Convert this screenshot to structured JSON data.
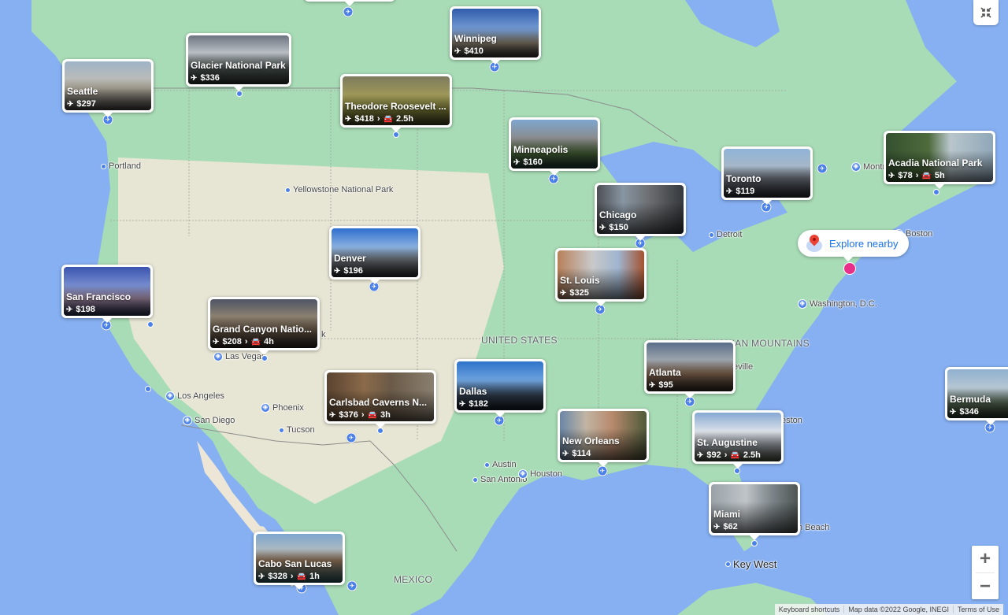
{
  "map": {
    "colors": {
      "water": "#86b0f2",
      "land_green": "#a8dcb6",
      "land_tan": "#efe9dc",
      "pin_blue": "#4a80e8",
      "current_location": "#e8308a",
      "explore_text": "#1a73e8"
    },
    "region_labels": [
      {
        "text": "UNITED STATES"
      },
      {
        "text": "MEXICO"
      },
      {
        "text": "APPALACHIAN MOUNTAINS"
      }
    ],
    "place_labels": [
      {
        "text": "Portland"
      },
      {
        "text": "Yellowstone National Park"
      },
      {
        "text": "Las Vegas"
      },
      {
        "text": "Los Angeles"
      },
      {
        "text": "San Diego"
      },
      {
        "text": "Phoenix"
      },
      {
        "text": "Tucson"
      },
      {
        "text": "Austin"
      },
      {
        "text": "San Antonio"
      },
      {
        "text": "Houston"
      },
      {
        "text": "Detroit"
      },
      {
        "text": "Boston"
      },
      {
        "text": "Washington, D.C."
      },
      {
        "text": "Montr"
      },
      {
        "text": "eville"
      },
      {
        "text": "eston"
      },
      {
        "text": "n Beach"
      },
      {
        "text": "Key West"
      },
      {
        "text": "k"
      }
    ],
    "destinations": [
      {
        "name": "Seattle",
        "price": "$297",
        "transfer": null
      },
      {
        "name": "Glacier National Park",
        "price": "$336",
        "transfer": null
      },
      {
        "name": "Winnipeg",
        "price": "$410",
        "transfer": null
      },
      {
        "name": "Theodore Roosevelt ...",
        "price": "$418",
        "transfer": "2.5h"
      },
      {
        "name": "Minneapolis",
        "price": "$160",
        "transfer": null
      },
      {
        "name": "Toronto",
        "price": "$119",
        "transfer": null
      },
      {
        "name": "Acadia National Park",
        "price": "$78",
        "transfer": "5h"
      },
      {
        "name": "Chicago",
        "price": "$150",
        "transfer": null
      },
      {
        "name": "Denver",
        "price": "$196",
        "transfer": null
      },
      {
        "name": "St. Louis",
        "price": "$325",
        "transfer": null
      },
      {
        "name": "San Francisco",
        "price": "$198",
        "transfer": null
      },
      {
        "name": "Grand Canyon Natio...",
        "price": "$208",
        "transfer": "4h"
      },
      {
        "name": "Atlanta",
        "price": "$95",
        "transfer": null
      },
      {
        "name": "Carlsbad Caverns N...",
        "price": "$376",
        "transfer": "3h"
      },
      {
        "name": "Dallas",
        "price": "$182",
        "transfer": null
      },
      {
        "name": "Bermuda",
        "price": "$346",
        "transfer": null
      },
      {
        "name": "New Orleans",
        "price": "$114",
        "transfer": null
      },
      {
        "name": "St. Augustine",
        "price": "$92",
        "transfer": "2.5h"
      },
      {
        "name": "Miami",
        "price": "$62",
        "transfer": null
      },
      {
        "name": "Cabo San Lucas",
        "price": "$328",
        "transfer": "1h"
      }
    ],
    "icons": {
      "flight": "✈",
      "car": "🚘",
      "chevron": "›"
    },
    "explore_nearby": {
      "label": "Explore nearby",
      "icon": "map-pin-icon"
    },
    "controls": {
      "exit_fullscreen": "exit-fullscreen-icon",
      "zoom_in": "+",
      "zoom_out": "−"
    },
    "attribution": {
      "keyboard_shortcuts": "Keyboard shortcuts",
      "map_data": "Map data ©2022 Google, INEGI",
      "terms": "Terms of Use"
    }
  }
}
